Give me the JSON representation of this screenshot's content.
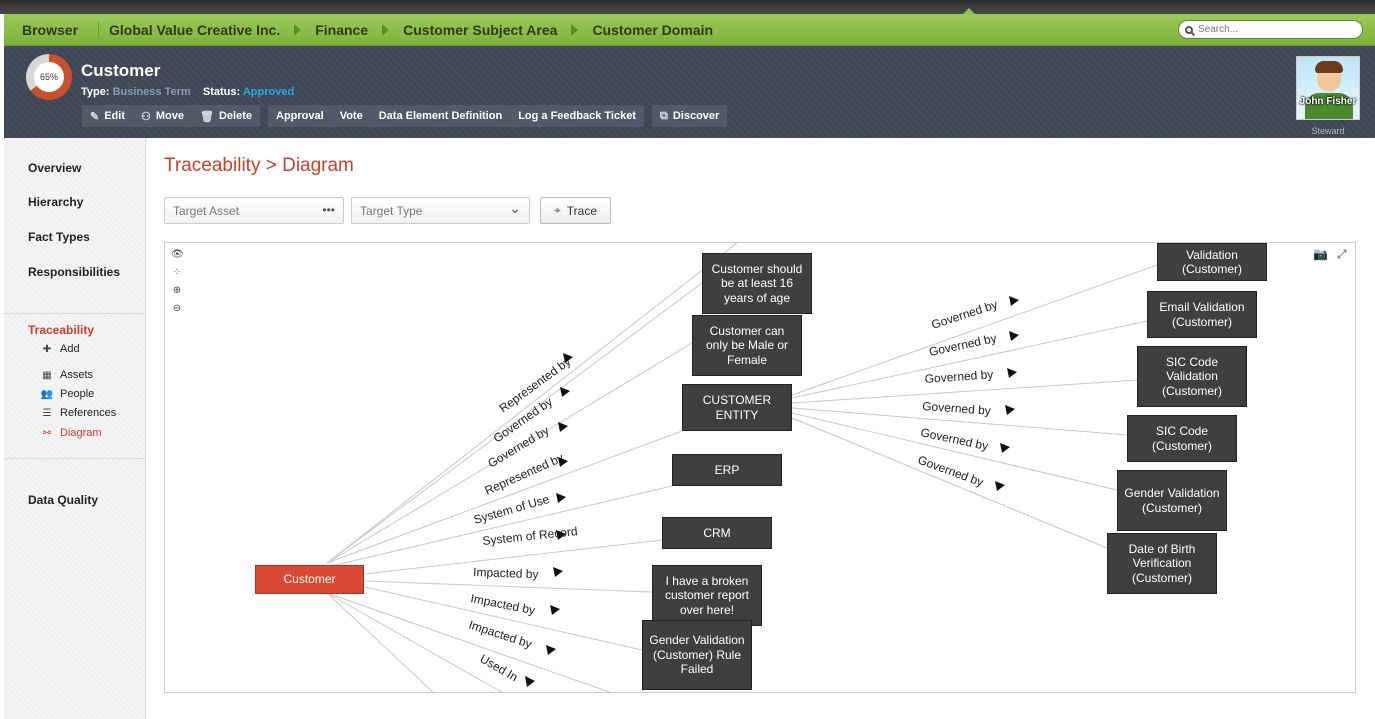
{
  "breadcrumb": {
    "root": "Browser",
    "items": [
      "Global Value Creative Inc.",
      "Finance",
      "Customer Subject Area",
      "Customer Domain"
    ]
  },
  "search": {
    "placeholder": "Search..."
  },
  "asset": {
    "completion": "65%",
    "completion_value": 0.65,
    "name": "Customer",
    "type_label": "Type:",
    "type_value": "Business Term",
    "status_label": "Status:",
    "status_value": "Approved"
  },
  "toolbar": {
    "edit": "Edit",
    "move": "Move",
    "delete": "Delete",
    "approval": "Approval",
    "vote": "Vote",
    "data_element_definition": "Data Element Definition",
    "feedback": "Log a Feedback Ticket",
    "discover": "Discover"
  },
  "steward": {
    "name": "John Fisher",
    "role": "Steward"
  },
  "sidebar": {
    "overview": "Overview",
    "hierarchy": "Hierarchy",
    "fact_types": "Fact Types",
    "responsibilities": "Responsibilities",
    "traceability": "Traceability",
    "sub": {
      "add": "Add",
      "assets": "Assets",
      "people": "People",
      "references": "References",
      "diagram": "Diagram"
    },
    "data_quality": "Data Quality"
  },
  "page": {
    "title": "Traceability > Diagram",
    "target_asset_placeholder": "Target Asset",
    "target_type_placeholder": "Target Type",
    "trace_button": "Trace"
  },
  "diagram": {
    "nodes": {
      "customer": "Customer",
      "age": "Customer should be at least 16 years of age",
      "gender_rule": "Customer can only be Male or Female",
      "entity": "CUSTOMER ENTITY",
      "erp": "ERP",
      "crm": "CRM",
      "broken": "I have a broken customer report over here!",
      "gender_failed": "Gender Validation (Customer) Rule Failed",
      "validation": "Validation (Customer)",
      "email": "Email Validation (Customer)",
      "sic_val": "SIC Code Validation (Customer)",
      "sic": "SIC Code (Customer)",
      "gender_val": "Gender Validation (Customer)",
      "dob": "Date of Birth Verification (Customer)"
    },
    "edges": {
      "represented_by": "Represented by",
      "governed_by": "Governed by",
      "system_of_use": "System of Use",
      "system_of_record": "System of Record",
      "impacted_by": "Impacted by",
      "used_in": "Used In"
    },
    "colors": {
      "root": "#d94a35",
      "node": "#3f3f3f",
      "line": "#c8c8c8"
    }
  }
}
